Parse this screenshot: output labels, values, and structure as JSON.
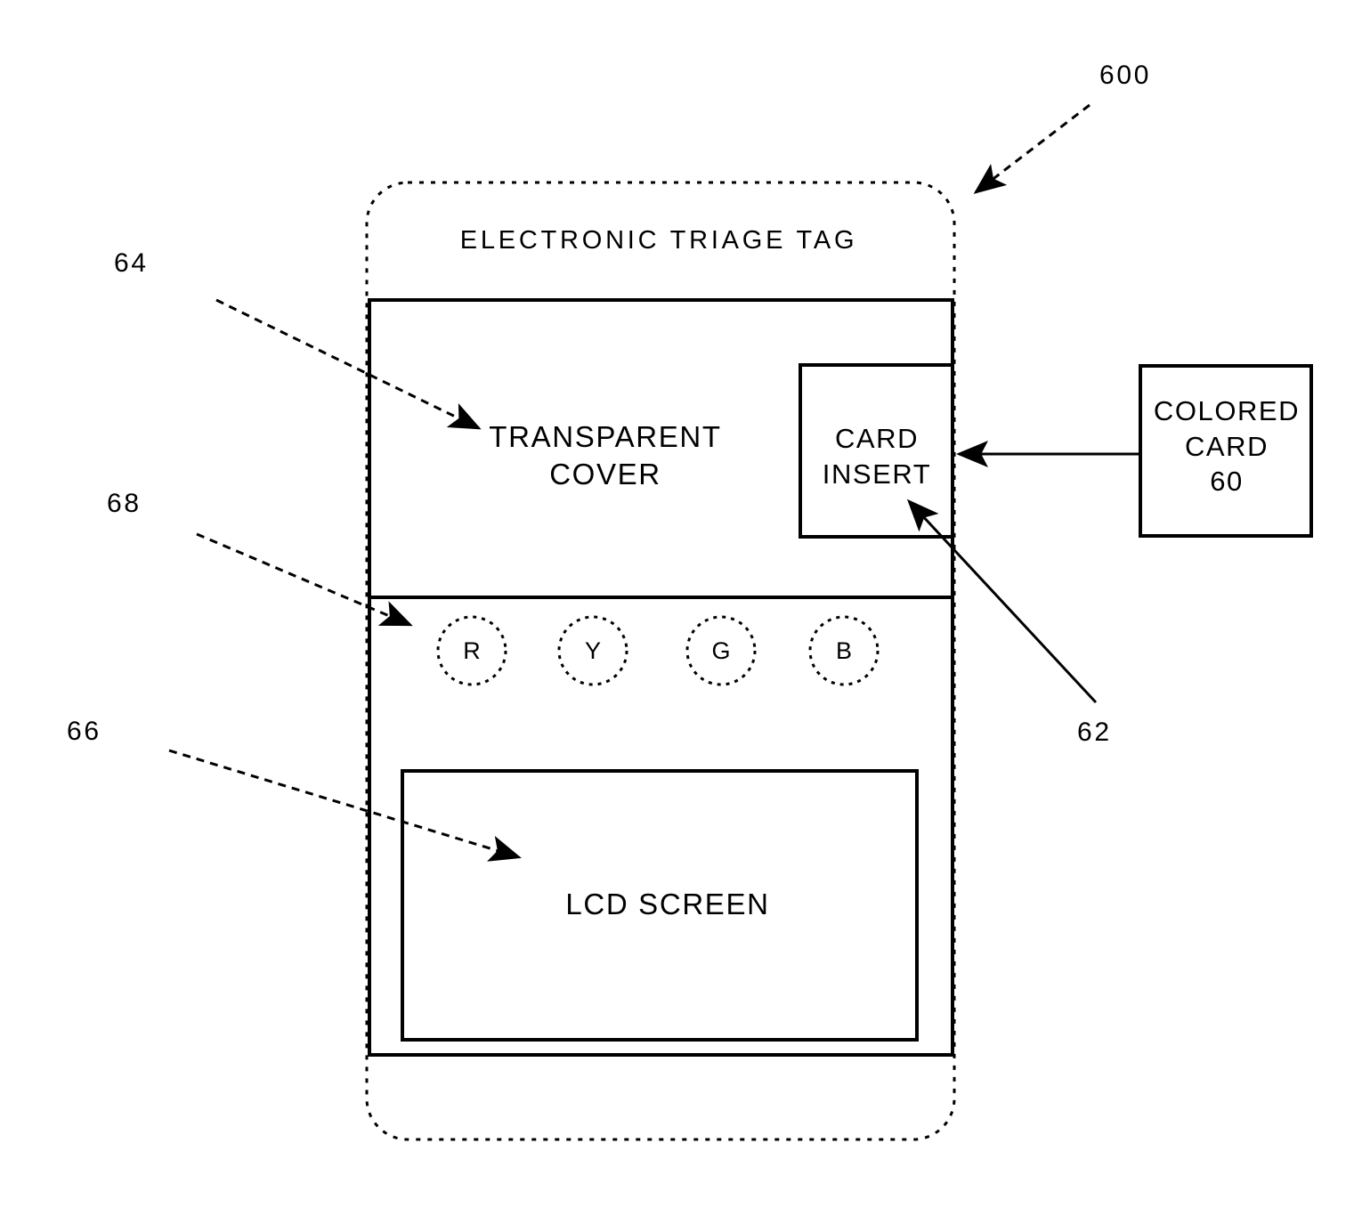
{
  "figure": {
    "device": {
      "title": "ELECTRONIC TRIAGE TAG",
      "reference": "600"
    },
    "transparent_cover": {
      "label": "TRANSPARENT\nCOVER",
      "reference": "64"
    },
    "card_insert": {
      "label": "CARD\nINSERT",
      "reference": "62"
    },
    "colored_card": {
      "label": "COLORED\nCARD\n60",
      "reference": "60"
    },
    "buttons": {
      "reference": "68",
      "items": [
        {
          "name": "red-button",
          "letter": "R"
        },
        {
          "name": "yellow-button",
          "letter": "Y"
        },
        {
          "name": "green-button",
          "letter": "G"
        },
        {
          "name": "blue-button",
          "letter": "B"
        }
      ]
    },
    "lcd_screen": {
      "label": "LCD SCREEN",
      "reference": "66"
    },
    "colors": {
      "line": "#000000",
      "background": "#ffffff"
    }
  }
}
